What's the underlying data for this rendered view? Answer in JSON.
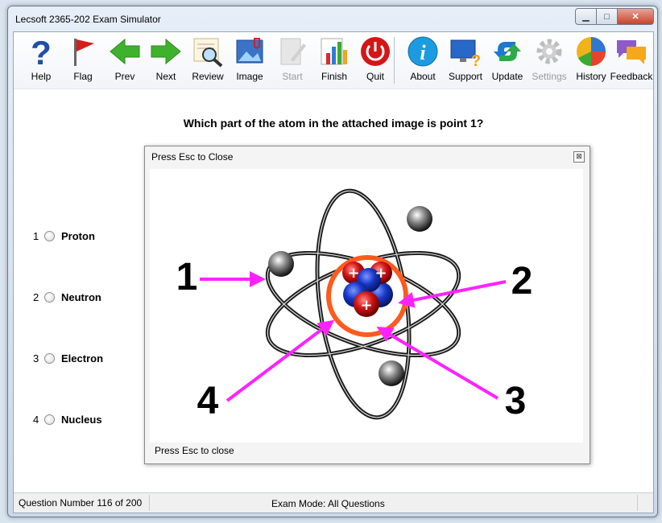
{
  "window": {
    "title": "Lecsoft 2365-202 Exam Simulator"
  },
  "toolbar": {
    "buttons": [
      {
        "label": "Help",
        "icon": "help-icon",
        "enabled": true
      },
      {
        "label": "Flag",
        "icon": "flag-icon",
        "enabled": true
      },
      {
        "label": "Prev",
        "icon": "prev-arrow-icon",
        "enabled": true
      },
      {
        "label": "Next",
        "icon": "next-arrow-icon",
        "enabled": true
      },
      {
        "label": "Review",
        "icon": "review-magnifier-icon",
        "enabled": true
      },
      {
        "label": "Image",
        "icon": "image-icon",
        "enabled": true
      },
      {
        "label": "Start",
        "icon": "start-icon",
        "enabled": false
      },
      {
        "label": "Finish",
        "icon": "finish-chart-icon",
        "enabled": true
      },
      {
        "label": "Quit",
        "icon": "power-icon",
        "enabled": true
      },
      {
        "label": "About",
        "icon": "info-icon",
        "enabled": true
      },
      {
        "label": "Support",
        "icon": "support-monitor-icon",
        "enabled": true
      },
      {
        "label": "Update",
        "icon": "update-arrows-icon",
        "enabled": true
      },
      {
        "label": "Settings",
        "icon": "gear-icon",
        "enabled": false
      },
      {
        "label": "History",
        "icon": "pie-chart-icon",
        "enabled": true
      },
      {
        "label": "Feedback",
        "icon": "speech-bubbles-icon",
        "enabled": true
      }
    ]
  },
  "question": {
    "text": "Which part of the atom in the attached image is point 1?",
    "options": [
      {
        "number": "1",
        "label": "Proton"
      },
      {
        "number": "2",
        "label": "Neutron"
      },
      {
        "number": "3",
        "label": "Electron"
      },
      {
        "number": "4",
        "label": "Nucleus"
      }
    ]
  },
  "popup": {
    "title": "Press Esc to Close",
    "footer": "Press Esc to close",
    "close_symbol": "⊠",
    "image_labels": [
      "1",
      "2",
      "3",
      "4"
    ],
    "proton_symbol": "+"
  },
  "status": {
    "question_number": "Question Number 116 of 200",
    "exam_mode": "Exam Mode: All Questions"
  },
  "colors": {
    "arrow": "#ff22ff",
    "nucleus_ring": "#ff5a1e",
    "proton": "#d11414",
    "neutron": "#1838c8"
  }
}
